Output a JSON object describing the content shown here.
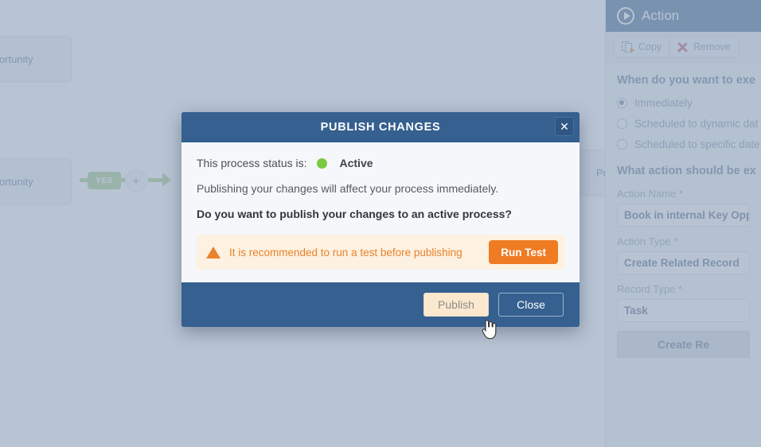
{
  "canvas": {
    "nodes": [
      {
        "name": "card-top",
        "text": "ortunity"
      },
      {
        "name": "card-mid",
        "text": "ortunity"
      },
      {
        "name": "card-right",
        "text": "Prim"
      }
    ],
    "branch_label": "YES",
    "add_step_icon": "plus-icon"
  },
  "side_panel": {
    "header": {
      "title": "Action",
      "icon": "play-circle-icon"
    },
    "toolbar": {
      "copy_label": "Copy",
      "copy_icon": "copy-icon",
      "remove_label": "Remove",
      "remove_icon": "close-x-icon"
    },
    "when_section_title": "When do you want to exe",
    "when_options": [
      {
        "label": "Immediately",
        "selected": true
      },
      {
        "label": "Scheduled to dynamic dat",
        "selected": false
      },
      {
        "label": "Scheduled to specific date",
        "selected": false
      }
    ],
    "what_section_title": "What action should be ex",
    "fields": [
      {
        "label": "Action Name *",
        "value": "Book in internal Key Oppo"
      },
      {
        "label": "Action Type *",
        "value": "Create Related Record"
      },
      {
        "label": "Record Type *",
        "value": "Task"
      }
    ],
    "primary_button": "Create Re"
  },
  "modal": {
    "title": "PUBLISH CHANGES",
    "close_icon": "close-x-icon",
    "status_prefix": "This process status is:",
    "status_value": "Active",
    "status_color": "#7ac943",
    "info_text": "Publishing your changes will affect your process immediately.",
    "question_text": "Do you want to publish your changes to an active process?",
    "warning": {
      "icon": "warning-triangle-icon",
      "text": "It is recommended to run a test before publishing",
      "button_label": "Run Test",
      "button_color": "#ef7c23"
    },
    "footer": {
      "publish_label": "Publish",
      "close_label": "Close"
    }
  },
  "cursor": {
    "icon": "pointing-hand-cursor"
  }
}
